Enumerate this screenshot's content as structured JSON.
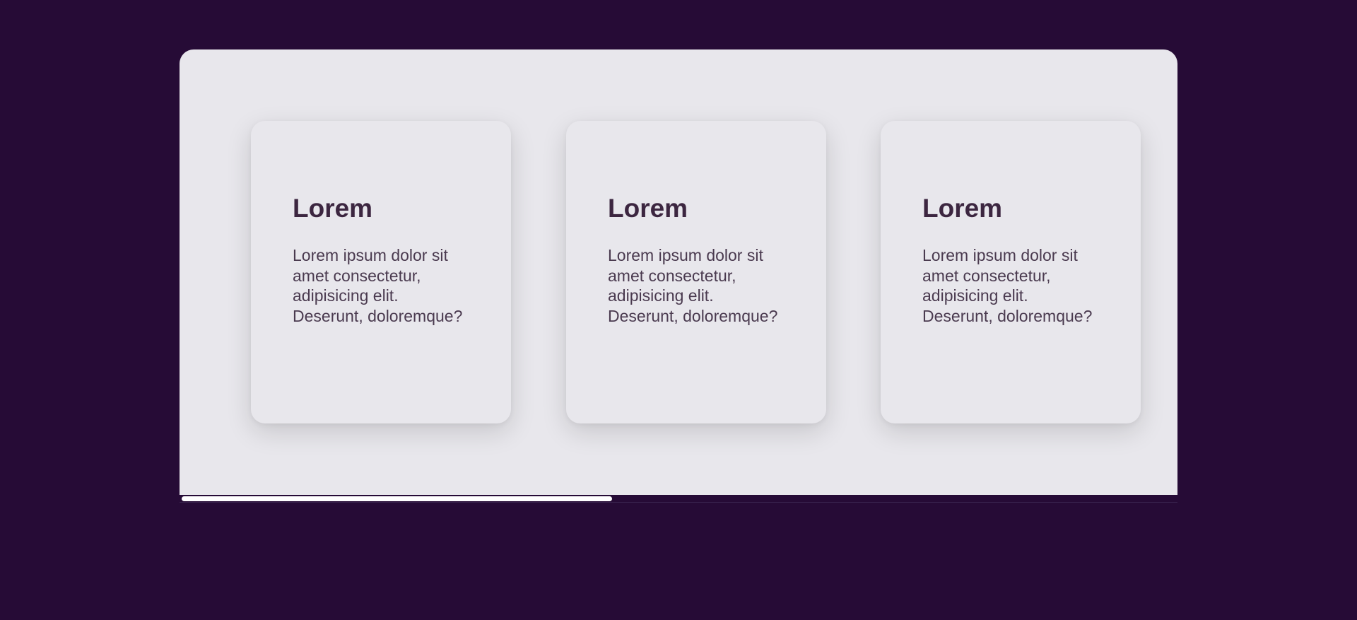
{
  "cards": [
    {
      "title": "Lorem",
      "text": "Lorem ipsum dolor sit amet consectetur, adipisicing elit. Deserunt, doloremque?"
    },
    {
      "title": "Lorem",
      "text": "Lorem ipsum dolor sit amet consectetur, adipisicing elit. Deserunt, doloremque?"
    },
    {
      "title": "Lorem",
      "text": "Lorem ipsum dolor sit amet consectetur, adipisicing elit. Deserunt, doloremque?"
    }
  ],
  "scrollbar": {
    "position_fraction": 0.0,
    "visible_fraction": 0.433
  },
  "colors": {
    "background": "#260b36",
    "panel": "#e8e7ec",
    "title": "#3c2640",
    "text": "#4a3a4f",
    "scrollbar_thumb": "#ffffff"
  }
}
